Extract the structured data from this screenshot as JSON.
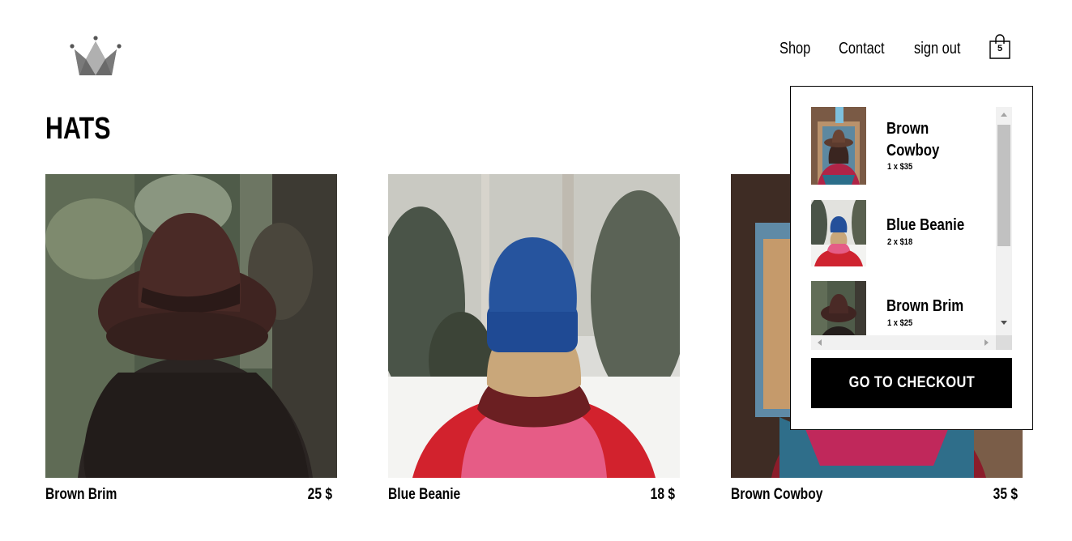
{
  "header": {
    "logo_icon": "crown-icon",
    "nav": {
      "shop": "Shop",
      "contact": "Contact",
      "sign_out": "sign out"
    },
    "cart_icon": "shopping-bag-icon",
    "cart_count": "5"
  },
  "page": {
    "title": "HATS"
  },
  "products": [
    {
      "name": "Brown Brim",
      "price": "25 $"
    },
    {
      "name": "Blue Beanie",
      "price": "18 $"
    },
    {
      "name": "Brown Cowboy",
      "price": "35 $"
    }
  ],
  "cart": {
    "items": [
      {
        "name_line1": "Brown",
        "name_line2": "Cowboy",
        "quantity": "1 x $35"
      },
      {
        "name": "Blue Beanie",
        "quantity": "2 x $18"
      },
      {
        "name": "Brown Brim",
        "quantity": "1 x $25"
      }
    ],
    "checkout_label": "GO TO CHECKOUT"
  },
  "colors": {
    "text": "#000000",
    "background": "#ffffff",
    "logo": "#808080",
    "button": "#000000"
  }
}
